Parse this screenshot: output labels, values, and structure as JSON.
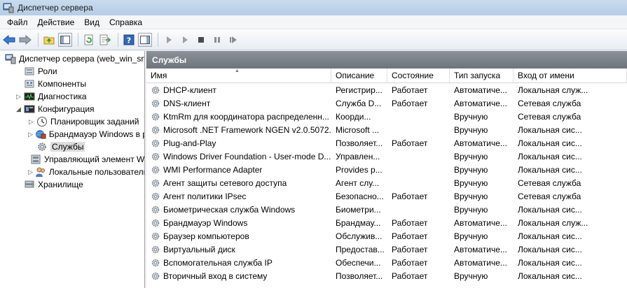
{
  "window": {
    "title": "Диспетчер сервера"
  },
  "menu": [
    "Файл",
    "Действие",
    "Вид",
    "Справка"
  ],
  "toolbar": {
    "icons": [
      "back-arrow-icon",
      "forward-arrow-icon",
      "folder-up-icon",
      "console-tree-icon",
      "refresh-icon",
      "export-list-icon",
      "help-icon",
      "action-pane-icon",
      "start-service-icon",
      "start-service-alt-icon",
      "stop-service-icon",
      "pause-service-icon",
      "restart-service-icon"
    ]
  },
  "tree": {
    "items": [
      {
        "label": "Диспетчер сервера (web_win_srv",
        "icon": "server-manager-icon",
        "level": 0,
        "expander": ""
      },
      {
        "label": "Роли",
        "icon": "roles-icon",
        "level": 1,
        "expander": ""
      },
      {
        "label": "Компоненты",
        "icon": "features-icon",
        "level": 1,
        "expander": ""
      },
      {
        "label": "Диагностика",
        "icon": "diagnostics-icon",
        "level": 1,
        "expander": "▷"
      },
      {
        "label": "Конфигурация",
        "icon": "configuration-icon",
        "level": 1,
        "expander": "◢"
      },
      {
        "label": "Планировщик заданий",
        "icon": "task-scheduler-icon",
        "level": 2,
        "expander": "▷"
      },
      {
        "label": "Брандмауэр Windows в ре",
        "icon": "firewall-icon",
        "level": 2,
        "expander": "▷"
      },
      {
        "label": "Службы",
        "icon": "services-icon",
        "level": 2,
        "expander": "",
        "selected": true
      },
      {
        "label": "Управляющий элемент W",
        "icon": "wmi-control-icon",
        "level": 2,
        "expander": ""
      },
      {
        "label": "Локальные пользователи",
        "icon": "local-users-icon",
        "level": 2,
        "expander": "▷"
      },
      {
        "label": "Хранилище",
        "icon": "storage-icon",
        "level": 1,
        "expander": ""
      }
    ]
  },
  "panel": {
    "title": "Службы",
    "columns": [
      "Имя",
      "Описание",
      "Состояние",
      "Тип запуска",
      "Вход от имени"
    ],
    "rows": [
      [
        "DHCP-клиент",
        "Регистрир...",
        "Работает",
        "Автоматиче...",
        "Локальная служ..."
      ],
      [
        "DNS-клиент",
        "Служба D...",
        "Работает",
        "Автоматиче...",
        "Сетевая служба"
      ],
      [
        "KtmRm для координатора распределенн...",
        "Коорди...",
        "",
        "Вручную",
        "Сетевая служба"
      ],
      [
        "Microsoft .NET Framework NGEN v2.0.5072...",
        "Microsoft ...",
        "",
        "Вручную",
        "Локальная сис..."
      ],
      [
        "Plug-and-Play",
        "Позволяет...",
        "Работает",
        "Автоматиче...",
        "Локальная сис..."
      ],
      [
        "Windows Driver Foundation - User-mode D...",
        "Управлен...",
        "",
        "Вручную",
        "Локальная сис..."
      ],
      [
        "WMI Performance Adapter",
        "Provides p...",
        "",
        "Вручную",
        "Локальная сис..."
      ],
      [
        "Агент защиты сетевого доступа",
        "Агент слу...",
        "",
        "Вручную",
        "Сетевая служба"
      ],
      [
        "Агент политики IPsec",
        "Безопасно...",
        "Работает",
        "Вручную",
        "Сетевая служба"
      ],
      [
        "Биометрическая служба Windows",
        "Биометри...",
        "",
        "Вручную",
        "Локальная сис..."
      ],
      [
        "Брандмауэр Windows",
        "Брандмау...",
        "Работает",
        "Автоматиче...",
        "Локальная служ..."
      ],
      [
        "Браузер компьютеров",
        "Обслужив...",
        "Работает",
        "Вручную",
        "Локальная сис..."
      ],
      [
        "Виртуальный диск",
        "Предостав...",
        "Работает",
        "Автоматиче...",
        "Локальная сис..."
      ],
      [
        "Вспомогательная служба IP",
        "Обеспечи...",
        "Работает",
        "Автоматиче...",
        "Локальная сис..."
      ],
      [
        "Вторичный вход в систему",
        "Позволяет...",
        "Работает",
        "Вручную",
        "Локальная сис..."
      ]
    ]
  },
  "colors": {
    "panel_header": "#7a7f86",
    "selection": "#dcdcdc",
    "titlebar": "#bfd3ea"
  }
}
